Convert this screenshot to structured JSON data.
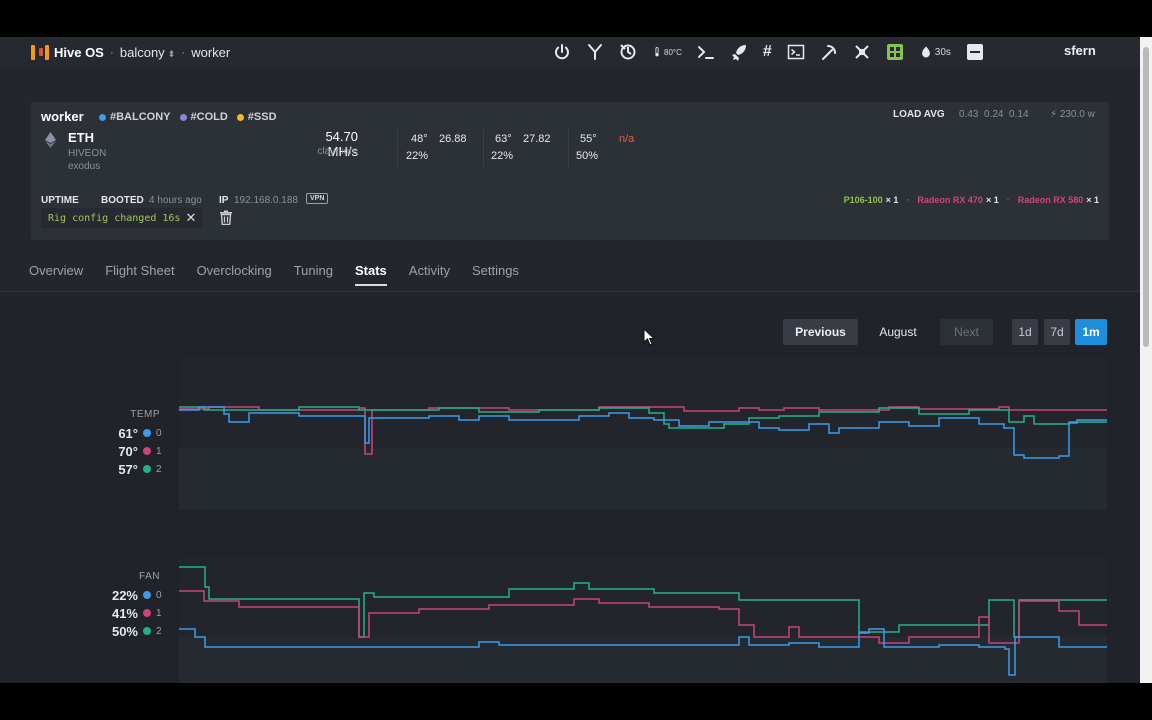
{
  "topbar": {
    "brand": "Hive OS",
    "farm": "balcony",
    "worker": "worker",
    "temp_badge": "80°C",
    "timer": "30s",
    "user": "sfern",
    "icons": [
      "power-icon",
      "tools-icon",
      "reboot-icon",
      "thermometer-icon",
      "terminal-icon",
      "rocket-icon",
      "hash-icon",
      "console-icon",
      "pickaxe-icon",
      "network-icon",
      "gpu-grid-icon",
      "watchdog-icon",
      "menu-icon"
    ]
  },
  "worker_card": {
    "name": "worker",
    "tags": [
      {
        "label": "#BALCONY",
        "color": "#3d9be9"
      },
      {
        "label": "#COLD",
        "color": "#8e84d6"
      },
      {
        "label": "#SSD",
        "color": "#f5b82e"
      }
    ],
    "coin": "ETH",
    "pool": "HIVEON",
    "wallet": "exodus",
    "hashrate": "54.70 MH/s",
    "miner": "claymore",
    "gpus": [
      {
        "temp": "48°",
        "hash": "26.88",
        "fan": "22%"
      },
      {
        "temp": "63°",
        "hash": "27.82",
        "fan": "22%"
      },
      {
        "temp": "55°",
        "hash": "n/a",
        "fan": "50%"
      }
    ],
    "load_avg_label": "LOAD AVG",
    "load_avg_values": "0.43  0.24  0.14",
    "power": "230.0 w",
    "uptime_label": "UPTIME",
    "booted_label": "BOOTED",
    "booted_value": "4 hours ago",
    "ip_label": "IP",
    "ip_value": "192.168.0.188",
    "vpn_label": "VPN",
    "message": "Rig config changed 16s",
    "gpu_models": [
      {
        "name": "P106-100",
        "count": "× 1"
      },
      {
        "name": "Radeon RX 470",
        "count": "× 1"
      },
      {
        "name": "Radeon RX 580",
        "count": "× 1"
      }
    ]
  },
  "tabs": [
    "Overview",
    "Flight Sheet",
    "Overclocking",
    "Tuning",
    "Stats",
    "Activity",
    "Settings"
  ],
  "active_tab": "Stats",
  "pager": {
    "previous": "Previous",
    "month": "August",
    "next": "Next",
    "ranges": [
      "1d",
      "7d",
      "1m"
    ],
    "active_range": "1m"
  },
  "colors": {
    "gpu0": "#3d9be9",
    "gpu1": "#c9437e",
    "gpu2": "#1fb28a",
    "accent": "#1e8ddb"
  },
  "temp_chart": {
    "label": "TEMP",
    "legend": [
      {
        "value": "61°",
        "index": "0"
      },
      {
        "value": "70°",
        "index": "1"
      },
      {
        "value": "57°",
        "index": "2"
      }
    ]
  },
  "fan_chart": {
    "label": "FAN",
    "legend": [
      {
        "value": "22%",
        "index": "0"
      },
      {
        "value": "41%",
        "index": "1"
      },
      {
        "value": "50%",
        "index": "2"
      }
    ]
  }
}
